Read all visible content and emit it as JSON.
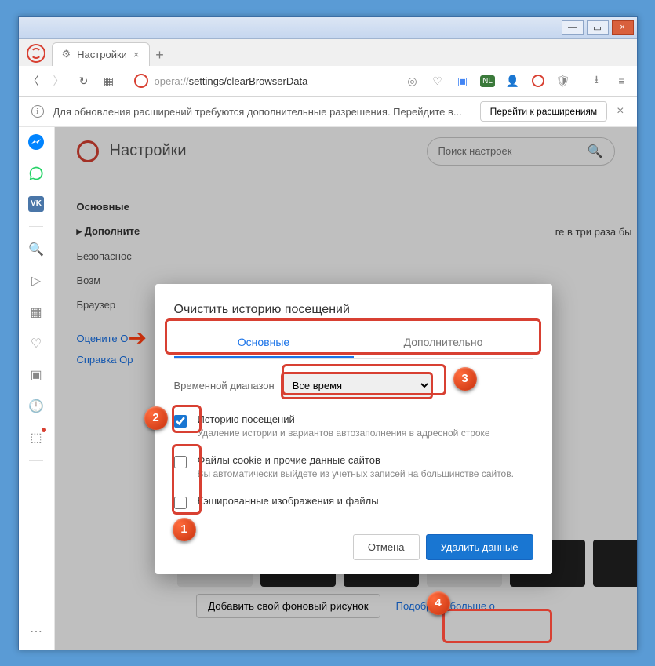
{
  "window": {
    "minimize": "—",
    "maximize": "▭",
    "close": "×"
  },
  "tab": {
    "title": "Настройки",
    "close": "×"
  },
  "toolbar": {
    "url_scheme": "opera://",
    "url_path": "settings/clearBrowserData"
  },
  "infobar": {
    "text": "Для обновления расширений требуются дополнительные разрешения. Перейдите в...",
    "button": "Перейти к расширениям",
    "close": "×"
  },
  "settings": {
    "title": "Настройки",
    "search_placeholder": "Поиск настроек",
    "nav": {
      "basic": "Основные",
      "advanced": "Дополните",
      "security": "Безопаснос",
      "features": "Возм",
      "browser": "Браузер",
      "rate": "Оцените О",
      "help": "Справка Op"
    },
    "hint": "ге в три раза бы"
  },
  "modal": {
    "title": "Очистить историю посещений",
    "tab_basic": "Основные",
    "tab_advanced": "Дополнительно",
    "range_label": "Временной диапазон",
    "range_value": "Все время",
    "check1": {
      "label": "Историю посещений",
      "sub": "Удаление истории и вариантов автозаполнения в адресной строке"
    },
    "check2": {
      "label": "Файлы cookie и прочие данные сайтов",
      "sub": "Вы автоматически выйдете из учетных записей на большинстве сайтов."
    },
    "check3": {
      "label": "Кэшированные изображения и файлы"
    },
    "cancel": "Отмена",
    "delete": "Удалить данные"
  },
  "wallpapers": {
    "add": "Добавить свой фоновый рисунок",
    "more": "Подобрать больше о"
  },
  "badges": {
    "b1": "1",
    "b2": "2",
    "b3": "3",
    "b4": "4"
  }
}
